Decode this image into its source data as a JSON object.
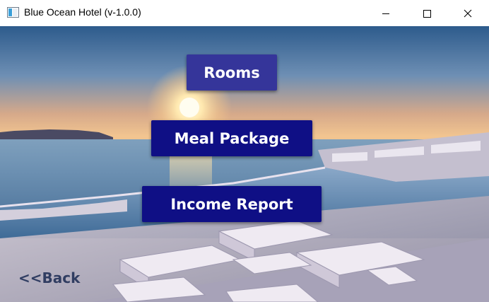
{
  "window": {
    "title": "Blue Ocean Hotel (v-1.0.0)",
    "controls": {
      "minimize_icon": "minimize-icon",
      "maximize_icon": "maximize-icon",
      "close_icon": "close-icon"
    }
  },
  "menu": {
    "rooms_label": "Rooms",
    "meal_package_label": "Meal Package",
    "income_report_label": "Income Report"
  },
  "navigation": {
    "back_label": "<<Back"
  },
  "colors": {
    "rooms_button": "#35359a",
    "primary_button": "#0f0f85",
    "back_text": "#1a2a52"
  }
}
